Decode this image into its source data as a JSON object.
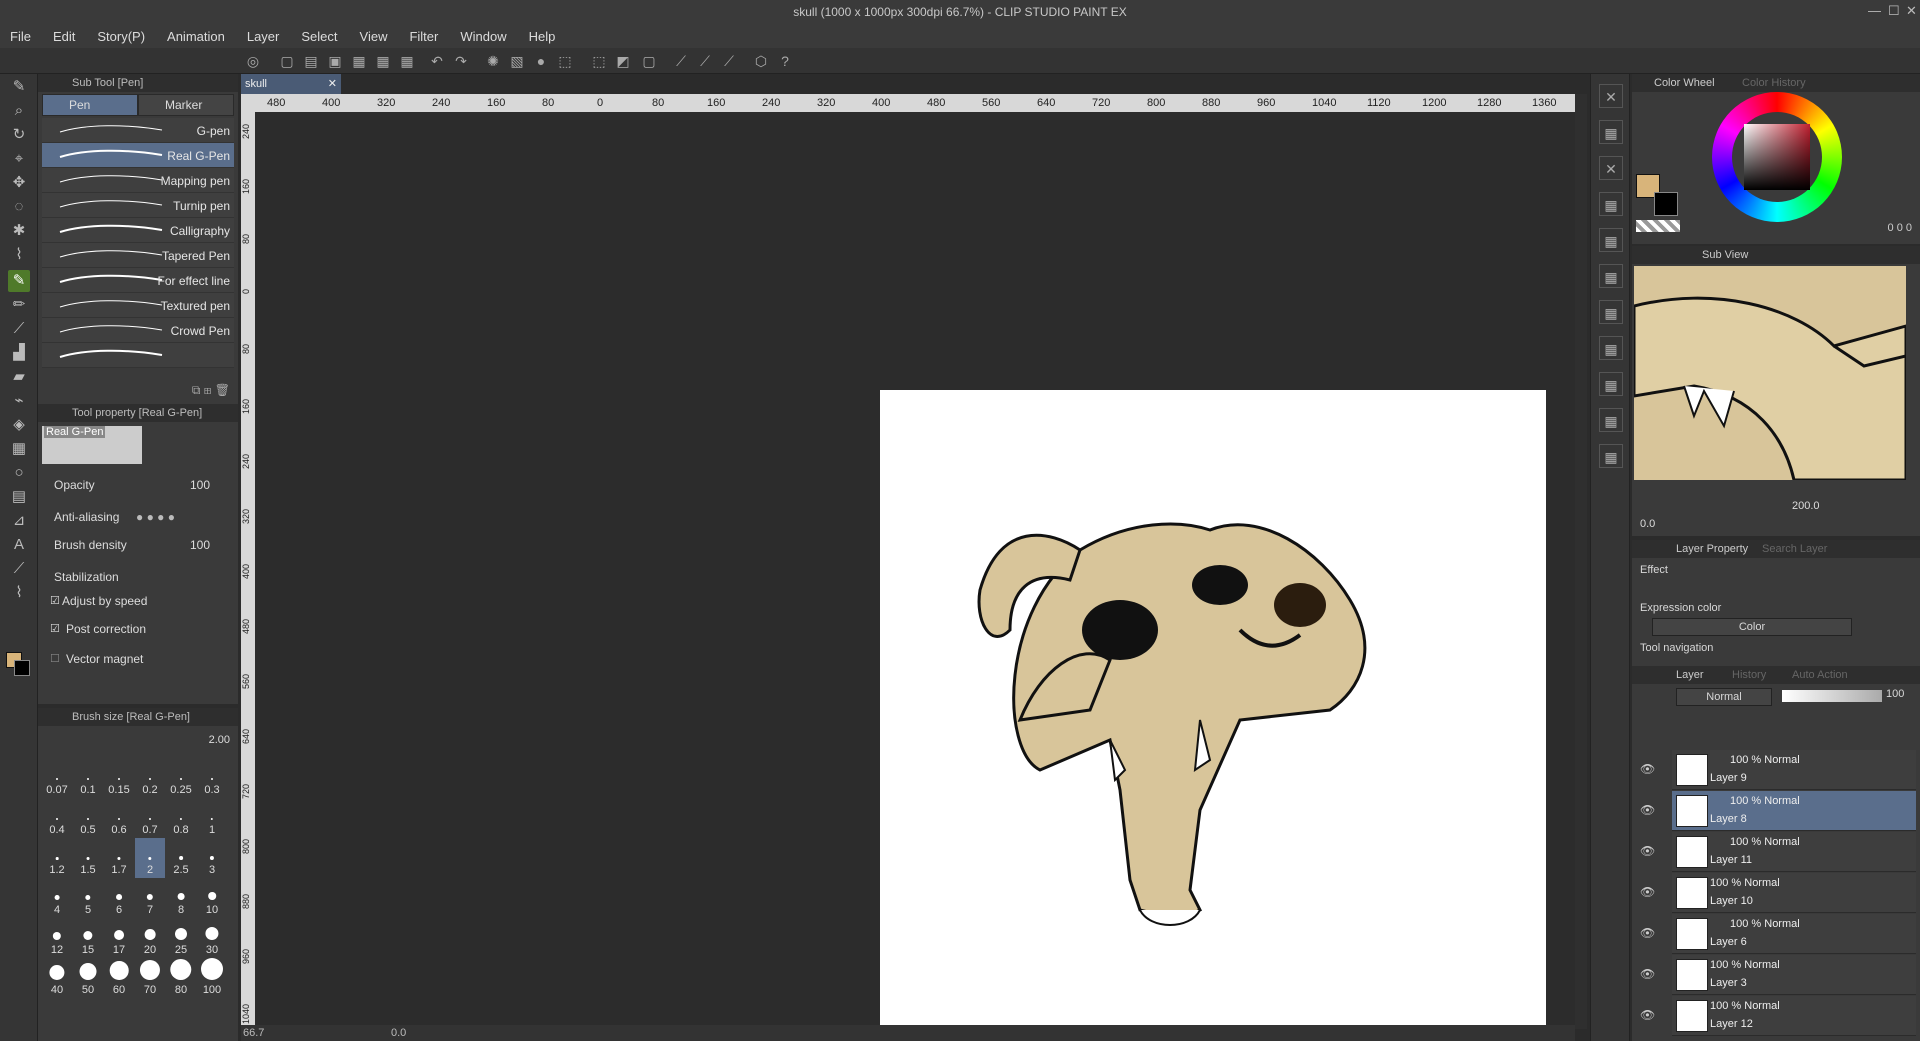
{
  "window": {
    "title": "skull (1000 x 1000px 300dpi 66.7%) - CLIP STUDIO PAINT EX"
  },
  "menu": [
    "File",
    "Edit",
    "Story(P)",
    "Animation",
    "Layer",
    "Select",
    "View",
    "Filter",
    "Window",
    "Help"
  ],
  "subtool": {
    "panel_title": "Sub Tool [Pen]",
    "tabs": [
      "Pen",
      "Marker"
    ],
    "brushes": [
      "G-pen",
      "Real G-Pen",
      "Mapping pen",
      "Turnip pen",
      "Calligraphy",
      "Tapered Pen",
      "For effect line",
      "Textured pen",
      "Crowd Pen",
      ""
    ],
    "selected_brush": "Real G-Pen"
  },
  "tool_property": {
    "panel_title": "Tool property [Real G-Pen]",
    "preview_label": "Real G-Pen",
    "opacity_label": "Opacity",
    "opacity_value": "100",
    "antialias_label": "Anti-aliasing",
    "density_label": "Brush density",
    "density_value": "100",
    "stabilization_label": "Stabilization",
    "adjust_label": "Adjust by speed",
    "post_label": "Post correction",
    "vector_label": "Vector magnet"
  },
  "brush_size": {
    "panel_title": "Brush size [Real G-Pen]",
    "value": "2.00",
    "presets": [
      "0.07",
      "0.1",
      "0.15",
      "0.2",
      "0.25",
      "0.3",
      "0.4",
      "0.5",
      "0.6",
      "0.7",
      "0.8",
      "1",
      "1.2",
      "1.5",
      "1.7",
      "2",
      "2.5",
      "3",
      "4",
      "5",
      "6",
      "7",
      "8",
      "10",
      "12",
      "15",
      "17",
      "20",
      "25",
      "30",
      "40",
      "50",
      "60",
      "70",
      "80",
      "100"
    ],
    "selected": "2"
  },
  "document": {
    "tab": "skull",
    "ruler_h": [
      "480",
      "400",
      "320",
      "240",
      "160",
      "80",
      "0",
      "80",
      "160",
      "240",
      "320",
      "400",
      "480",
      "560",
      "640",
      "720",
      "800",
      "880",
      "960",
      "1040",
      "1120",
      "1200",
      "1280",
      "1360"
    ],
    "ruler_v": [
      "240",
      "160",
      "80",
      "0",
      "80",
      "160",
      "240",
      "320",
      "400",
      "480",
      "560",
      "640",
      "720",
      "800",
      "880",
      "960",
      "1040"
    ],
    "zoom": "66.7",
    "rotation": "0.0"
  },
  "color_panel": {
    "tab_active": "Color Wheel",
    "tab_inactive": "Color History",
    "readouts": [
      "0",
      "0",
      "0"
    ],
    "main_color": "#d8b47a",
    "sub_color": "#000000",
    "accent": "#5a6e8c"
  },
  "subview": {
    "tab": "Sub View",
    "zoom_value": "200.0",
    "rotate_value": "0.0"
  },
  "layer_property": {
    "tab_active": "Layer Property",
    "tab_inactive": "Search Layer",
    "effect_label": "Effect",
    "expression_label": "Expression color",
    "expression_value": "Color",
    "nav_label": "Tool navigation"
  },
  "layers": {
    "tabs": [
      "Layer",
      "History",
      "Auto Action"
    ],
    "blend_mode": "Normal",
    "opacity": "100",
    "items": [
      {
        "blend": "100 % Normal",
        "name": "Layer 9",
        "selected": false
      },
      {
        "blend": "100 % Normal",
        "name": "Layer 8",
        "selected": true
      },
      {
        "blend": "100 % Normal",
        "name": "Layer 11",
        "selected": false
      },
      {
        "blend": "100 % Normal",
        "name": "Layer 10",
        "selected": false
      },
      {
        "blend": "100 % Normal",
        "name": "Layer 6",
        "selected": false
      },
      {
        "blend": "100 % Normal",
        "name": "Layer 3",
        "selected": false
      },
      {
        "blend": "100 % Normal",
        "name": "Layer 12",
        "selected": false
      }
    ]
  }
}
